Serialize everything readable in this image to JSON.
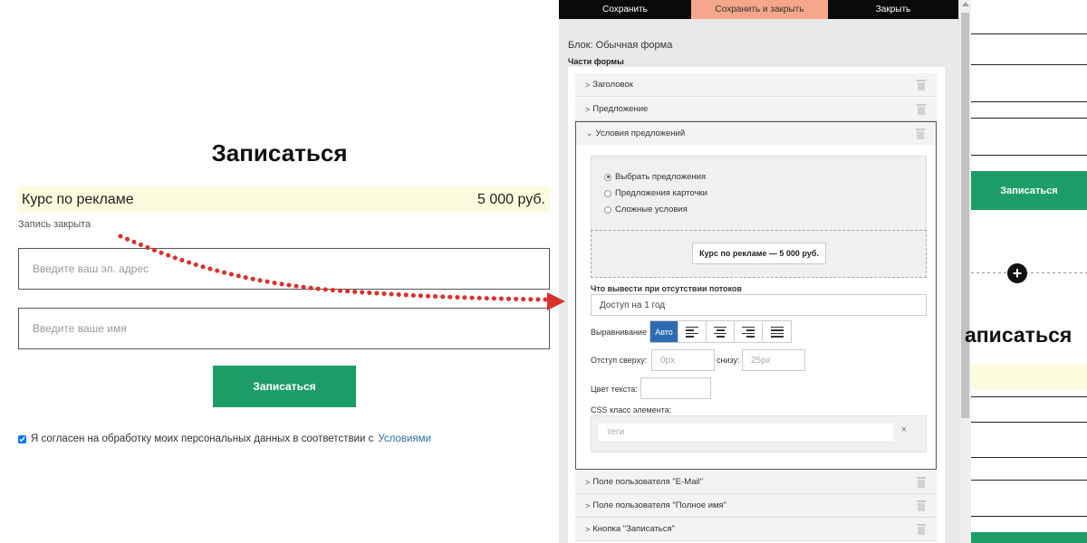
{
  "preview": {
    "title": "Записаться",
    "offer": {
      "name": "Курс по рекламе",
      "price": "5 000 руб."
    },
    "closed_note": "Запись закрыта",
    "email_placeholder": "Введите ваш эл. адрес",
    "name_placeholder": "Введите ваше имя",
    "submit_label": "Записаться",
    "consent_text": "Я согласен на обработку моих персональных данных в соответствии с",
    "consent_link": "Условиями",
    "consent_checked": true
  },
  "editor": {
    "toolbar": {
      "save": "Сохранить",
      "save_close": "Сохранить и закрыть",
      "close": "Закрыть"
    },
    "block_label": "Блок: Обычная форма",
    "parts_label": "Части формы",
    "parts": {
      "header": "Заголовок",
      "offer": "Предложение",
      "conditions": "Условия предложений",
      "email_field": "Поле пользователя \"E-Mail\"",
      "name_field": "Поле пользователя \"Полное имя\"",
      "button": "Кнопка \"Записаться\""
    },
    "conditions": {
      "radios": [
        {
          "label": "Выбрать предложения",
          "selected": true
        },
        {
          "label": "Предложения карточки",
          "selected": false
        },
        {
          "label": "Сложные условия",
          "selected": false
        }
      ],
      "offer_chip": "Курс по рекламе — 5 000 руб.",
      "no_stream_label": "Что вывести при отсутствии потоков",
      "no_stream_value": "Доступ на 1 год",
      "align_label": "Выравнивание",
      "align_auto": "Авто",
      "margin_top_label": "Отступ сверху:",
      "margin_top_placeholder": "0px",
      "margin_bottom_label": "снизу:",
      "margin_bottom_placeholder": "25px",
      "text_color_label": "Цвет текста:",
      "css_class_label": "CSS класс элемента:",
      "css_placeholder": "теги",
      "css_clear": "×"
    }
  },
  "right_canvas": {
    "button_label": "Записаться",
    "add_icon": "+",
    "title_fragment": "аписаться"
  },
  "colors": {
    "green": "#1e9e67",
    "accent_orange": "#f6a68a",
    "offer_bg": "#fdfbdd",
    "active_blue": "#2e6db4",
    "arrow_red": "#d8322b"
  }
}
